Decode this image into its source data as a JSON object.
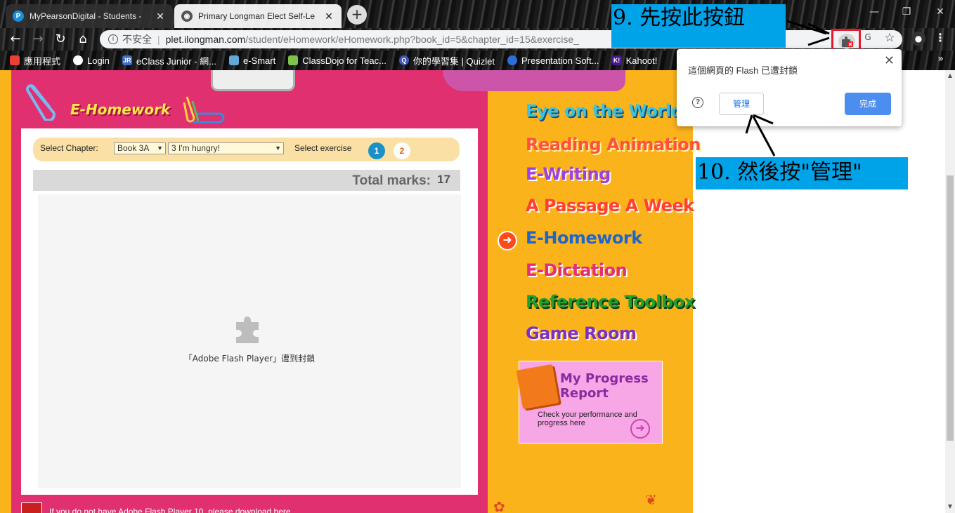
{
  "browser": {
    "tabs": [
      {
        "title": "MyPearsonDigital - Students -",
        "favicon": "P"
      },
      {
        "title": "Primary Longman Elect Self-Le",
        "favicon": "globe-icon"
      }
    ],
    "address": {
      "security_label": "不安全",
      "domain": "plet.ilongman.com",
      "path": "/student/eHomework/eHomework.php?book_id=5&chapter_id=15&exercise_"
    },
    "bookmarks": [
      {
        "label": "應用程式",
        "color": "#e94235"
      },
      {
        "label": "Login",
        "color": "#ffffff"
      },
      {
        "label": "eClass Junior - 網...",
        "color": "#3b6fc8"
      },
      {
        "label": "e-Smart",
        "color": "#5fa8d8"
      },
      {
        "label": "ClassDojo for Teac...",
        "color": "#7fc24a"
      },
      {
        "label": "你的學習集 | Quizlet",
        "color": "#4257b2"
      },
      {
        "label": "Presentation Soft...",
        "color": "#2c6fd6"
      },
      {
        "label": "Kahoot!",
        "color": "#46178f"
      }
    ],
    "bookmarks_more": "»"
  },
  "page": {
    "ehomework_title": "E-Homework",
    "select_chapter_label": "Select Chapter:",
    "book_value": "Book 3A",
    "chapter_value": "3 I'm hungry!",
    "select_exercise_label": "Select exercise",
    "exercises": [
      "1",
      "2"
    ],
    "total_marks_label": "Total marks:",
    "total_marks_value": "17",
    "flash_blocked_text": "「Adobe Flash Player」遭到封鎖",
    "download_text": "If you do not have Adobe Flash Player 10, please download here."
  },
  "nav": {
    "items": [
      "Eye on the World",
      "Reading Animation",
      "E-Writing",
      "A Passage A Week",
      "E-Homework",
      "E-Dictation",
      "Reference Toolbox",
      "Game Room"
    ],
    "active_index": 4,
    "progress_title": "My Progress Report",
    "progress_subtitle": "Check your performance and progress here"
  },
  "popup": {
    "message": "這個網頁的 Flash 已遭封鎖",
    "manage_label": "管理",
    "done_label": "完成"
  },
  "annotations": {
    "step9": "9. 先按此按鈕",
    "step10": "10. 然後按\"管理\""
  },
  "colors": {
    "pink_panel": "#e0306f",
    "orange_panel": "#fbb31c",
    "highlight_red": "#e8192c",
    "annotation_blue": "#00a2e8"
  }
}
